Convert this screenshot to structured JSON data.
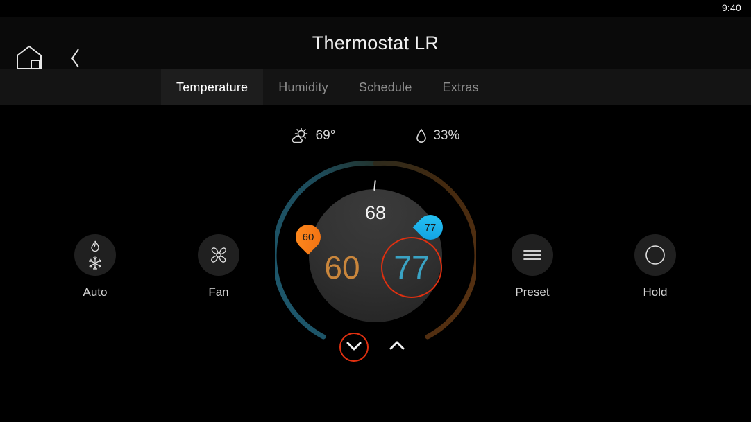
{
  "status_bar": {
    "clock": "9:40"
  },
  "header": {
    "home_icon": "home-icon",
    "back_icon": "back-chevron-icon",
    "title": "Thermostat LR"
  },
  "tabs": [
    {
      "label": "Temperature",
      "active": true
    },
    {
      "label": "Humidity",
      "active": false
    },
    {
      "label": "Schedule",
      "active": false
    },
    {
      "label": "Extras",
      "active": false
    }
  ],
  "weather": {
    "outdoor_temp": "69°",
    "outdoor_temp_icon": "sun-cloud-icon",
    "outdoor_humidity": "33%",
    "outdoor_humidity_icon": "water-drop-icon"
  },
  "dial": {
    "current_temp": "68",
    "heat_setpoint": "60",
    "cool_setpoint": "77",
    "heat_badge": "60",
    "cool_badge": "77",
    "decrease_icon": "chevron-down-icon",
    "increase_icon": "chevron-up-icon"
  },
  "controls": [
    {
      "label": "Auto",
      "icon": "flame-snowflake-icon"
    },
    {
      "label": "Fan",
      "icon": "fan-icon"
    },
    {
      "label": "Preset",
      "icon": "hamburger-menu-icon"
    },
    {
      "label": "Hold",
      "icon": "circle-outline-icon"
    }
  ],
  "colors": {
    "background": "#000000",
    "heat": "#c9863c",
    "heat_badge": "#f58220",
    "cool": "#3aa3c4",
    "cool_badge": "#16b4ef",
    "focus_ring": "#e03010",
    "arc_cool": "#1d4d5e",
    "arc_heat": "#4d2a12",
    "active_tab_text": "#ffffff",
    "inactive_tab_text": "#8d8d8d"
  }
}
